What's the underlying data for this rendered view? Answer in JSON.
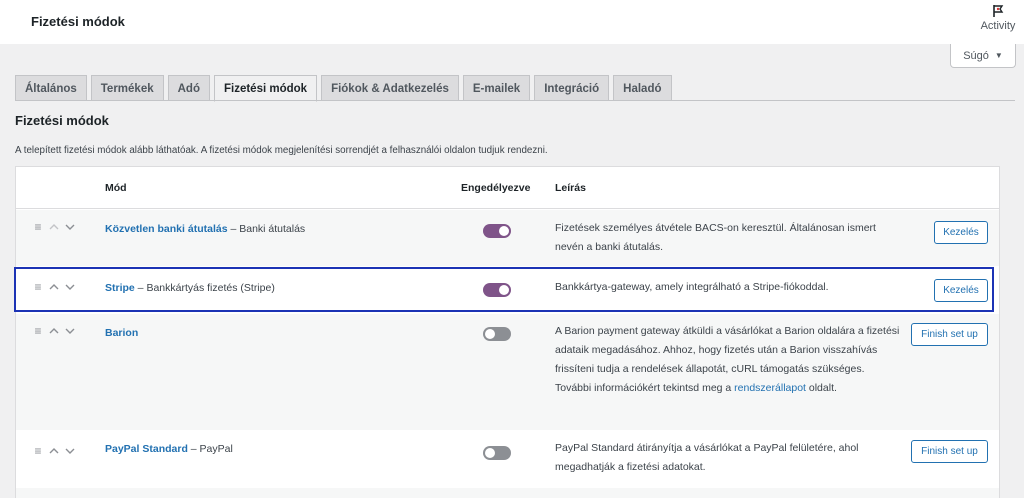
{
  "header": {
    "title": "Fizetési módok",
    "activity_label": "Activity",
    "help_label": "Súgó"
  },
  "tabs": [
    {
      "label": "Általános"
    },
    {
      "label": "Termékek"
    },
    {
      "label": "Adó"
    },
    {
      "label": "Fizetési módok",
      "active": true
    },
    {
      "label": "Fiókok & Adatkezelés"
    },
    {
      "label": "E-mailek"
    },
    {
      "label": "Integráció"
    },
    {
      "label": "Haladó"
    }
  ],
  "section": {
    "title": "Fizetési módok",
    "description": "A telepített fizetési módok alább láthatóak. A fizetési módok megjelenítési sorrendjét a felhasználói oldalon tudjuk rendezni."
  },
  "table": {
    "headers": {
      "method": "Mód",
      "enabled": "Engedélyezve",
      "description": "Leírás"
    },
    "rows": [
      {
        "name": "Közvetlen banki átutalás",
        "subtitle": " – Banki átutalás",
        "enabled": true,
        "description": "Fizetések személyes átvétele BACS-on keresztül. Általánosan ismert nevén a banki átutalás.",
        "action": "Kezelés"
      },
      {
        "name": "Stripe",
        "subtitle": " – Bankkártyás fizetés (Stripe)",
        "enabled": true,
        "description": "Bankkártya-gateway, amely integrálható a Stripe-fiókoddal.",
        "action": "Kezelés"
      },
      {
        "name": "Barion",
        "subtitle": "",
        "enabled": false,
        "description_before": "A Barion payment gateway átküldi a vásárlókat a Barion oldalára a fizetési adataik megadásához. Ahhoz, hogy fizetés után a Barion visszahívás frissíteni tudja a rendelések állapotát, cURL támogatás szükséges. További információkért tekintsd meg a ",
        "description_link": "rendszerállapot",
        "description_after": " oldalt.",
        "action": "Finish set up"
      },
      {
        "name": "PayPal Standard",
        "subtitle": " – PayPal",
        "enabled": false,
        "description": "PayPal Standard átirányítja a vásárlókat a PayPal felületére, ahol megadhatják a fizetési adatokat.",
        "action": "Finish set up"
      }
    ]
  },
  "colors": {
    "toggle_on": "#7f5489",
    "toggle_off": "#8c8f94",
    "link": "#2271b1",
    "highlight": "#1c33b5"
  }
}
